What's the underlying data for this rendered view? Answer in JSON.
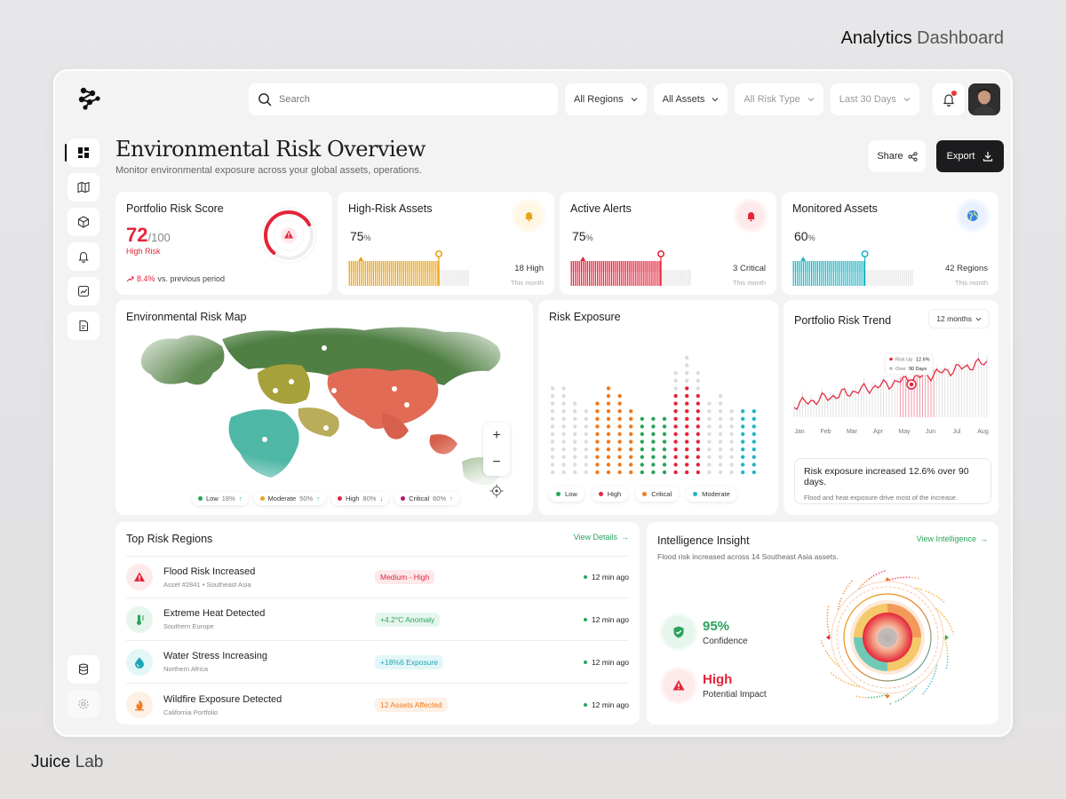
{
  "brand": {
    "top_bold": "Analytics",
    "top_light": "Dashboard",
    "bottom_bold": "Juice",
    "bottom_light": "Lab"
  },
  "search": {
    "placeholder": "Search"
  },
  "filters": [
    "All Regions",
    "All Assets",
    "All Risk Type",
    "Last 30 Days"
  ],
  "header": {
    "title": "Environmental Risk Overview",
    "subtitle": "Monitor environmental exposure across your global assets, operations.",
    "share_label": "Share",
    "export_label": "Export"
  },
  "portfolio_score": {
    "title": "Portfolio Risk Score",
    "score": "72",
    "denominator": "/100",
    "score_fraction": 0.72,
    "level": "High Risk",
    "change": "8.4%",
    "change_text": "vs. previous period"
  },
  "kpis": [
    {
      "title": "High-Risk Assets",
      "percent": "75",
      "unit": "%",
      "count": "18 High",
      "period": "This month",
      "color": "#e8a317",
      "icon": "bell-icon"
    },
    {
      "title": "Active Alerts",
      "percent": "75",
      "unit": "%",
      "count": "3 Critical",
      "period": "This month",
      "color": "#e5243b",
      "icon": "alarm-icon"
    },
    {
      "title": "Monitored Assets",
      "percent": "60",
      "unit": "%",
      "count": "42 Regions",
      "period": "This month",
      "color": "#24b5c4",
      "icon": "globe-icon"
    }
  ],
  "risk_map": {
    "title": "Environmental Risk Map",
    "legend": [
      {
        "label": "Low",
        "percent": "18%",
        "trend": "up",
        "color": "#2aa35c"
      },
      {
        "label": "Moderate",
        "percent": "50%",
        "trend": "up",
        "color": "#e8a317"
      },
      {
        "label": "High",
        "percent": "80%",
        "trend": "down",
        "color": "#e5243b"
      },
      {
        "label": "Critical",
        "percent": "60%",
        "trend": "up",
        "color": "#b0176b"
      }
    ]
  },
  "risk_exposure": {
    "title": "Risk Exposure",
    "legend": [
      {
        "label": "Low",
        "color": "#2aa35c"
      },
      {
        "label": "High",
        "color": "#e5243b"
      },
      {
        "label": "Critical",
        "color": "#f07a1d"
      },
      {
        "label": "Moderate",
        "color": "#24b5c4"
      }
    ]
  },
  "trend": {
    "title": "Portfolio Risk Trend",
    "range_label": "12 months",
    "tooltip": {
      "label1": "Risk Up",
      "value1": "12.6%",
      "label2": "Over",
      "value2": "90 Days"
    },
    "months": [
      "Jan",
      "Feb",
      "Mar",
      "Apr",
      "May",
      "Jun",
      "Jul",
      "Aug"
    ],
    "insight_title": "Risk exposure increased 12.6% over 90 days.",
    "insight_sub": "Flood and heat exposure drive most of the increase."
  },
  "regions": {
    "title": "Top Risk Regions",
    "view_label": "View Details",
    "rows": [
      {
        "title": "Flood Risk Increased",
        "sub": "Asset #2841 • Southeast Asia",
        "tag": "Medium - High",
        "tag_color": "#e5243b",
        "tag_bg": "#fde8ea",
        "time": "12 min ago",
        "icon": "warning-icon",
        "icon_color": "#e5243b",
        "icon_bg": "#fdeaea"
      },
      {
        "title": "Extreme Heat Detected",
        "sub": "Southern Europe",
        "tag": "+4.2°C Anomaly",
        "tag_color": "#2aa35c",
        "tag_bg": "#e6f6ec",
        "time": "12 min ago",
        "icon": "thermometer-icon",
        "icon_color": "#2aa35c",
        "icon_bg": "#e6f6ec"
      },
      {
        "title": "Water Stress Increasing",
        "sub": "Northern Africa",
        "tag": "+18%6 Exposure",
        "tag_color": "#1ea5b5",
        "tag_bg": "#e3f6f8",
        "time": "12 min ago",
        "icon": "water-drop-icon",
        "icon_color": "#1ea5b5",
        "icon_bg": "#e3f6f8"
      },
      {
        "title": "Wildfire Exposure Detected",
        "sub": "California Portfolio",
        "tag": "12 Assets Affected",
        "tag_color": "#f07a1d",
        "tag_bg": "#fdf0e4",
        "time": "12 min ago",
        "icon": "fire-icon",
        "icon_color": "#f07a1d",
        "icon_bg": "#fdf0e4"
      }
    ]
  },
  "intelligence": {
    "title": "Intelligence Insight",
    "view_label": "View Intelligence",
    "sub": "Flood risk increased across 14 Southeast Asia assets.",
    "confidence_value": "95%",
    "confidence_label": "Confidence",
    "impact_value": "High",
    "impact_label": "Potential Impact"
  }
}
